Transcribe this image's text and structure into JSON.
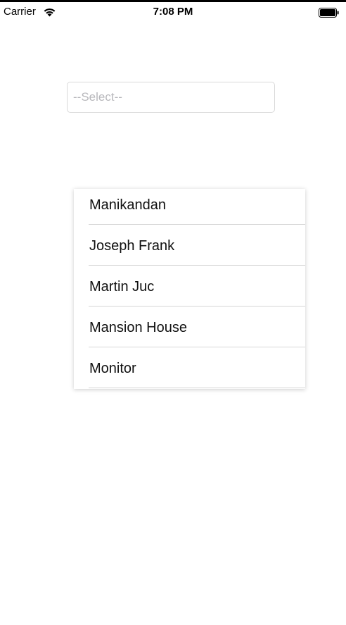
{
  "status_bar": {
    "carrier": "Carrier",
    "time": "7:08 PM",
    "wifi_icon": "wifi-icon",
    "battery_icon": "battery-icon"
  },
  "select": {
    "placeholder": "--Select--"
  },
  "dropdown": {
    "items": [
      {
        "label": "Manikandan"
      },
      {
        "label": "Joseph Frank"
      },
      {
        "label": "Martin Juc"
      },
      {
        "label": "Mansion House"
      },
      {
        "label": "Monitor"
      }
    ]
  }
}
